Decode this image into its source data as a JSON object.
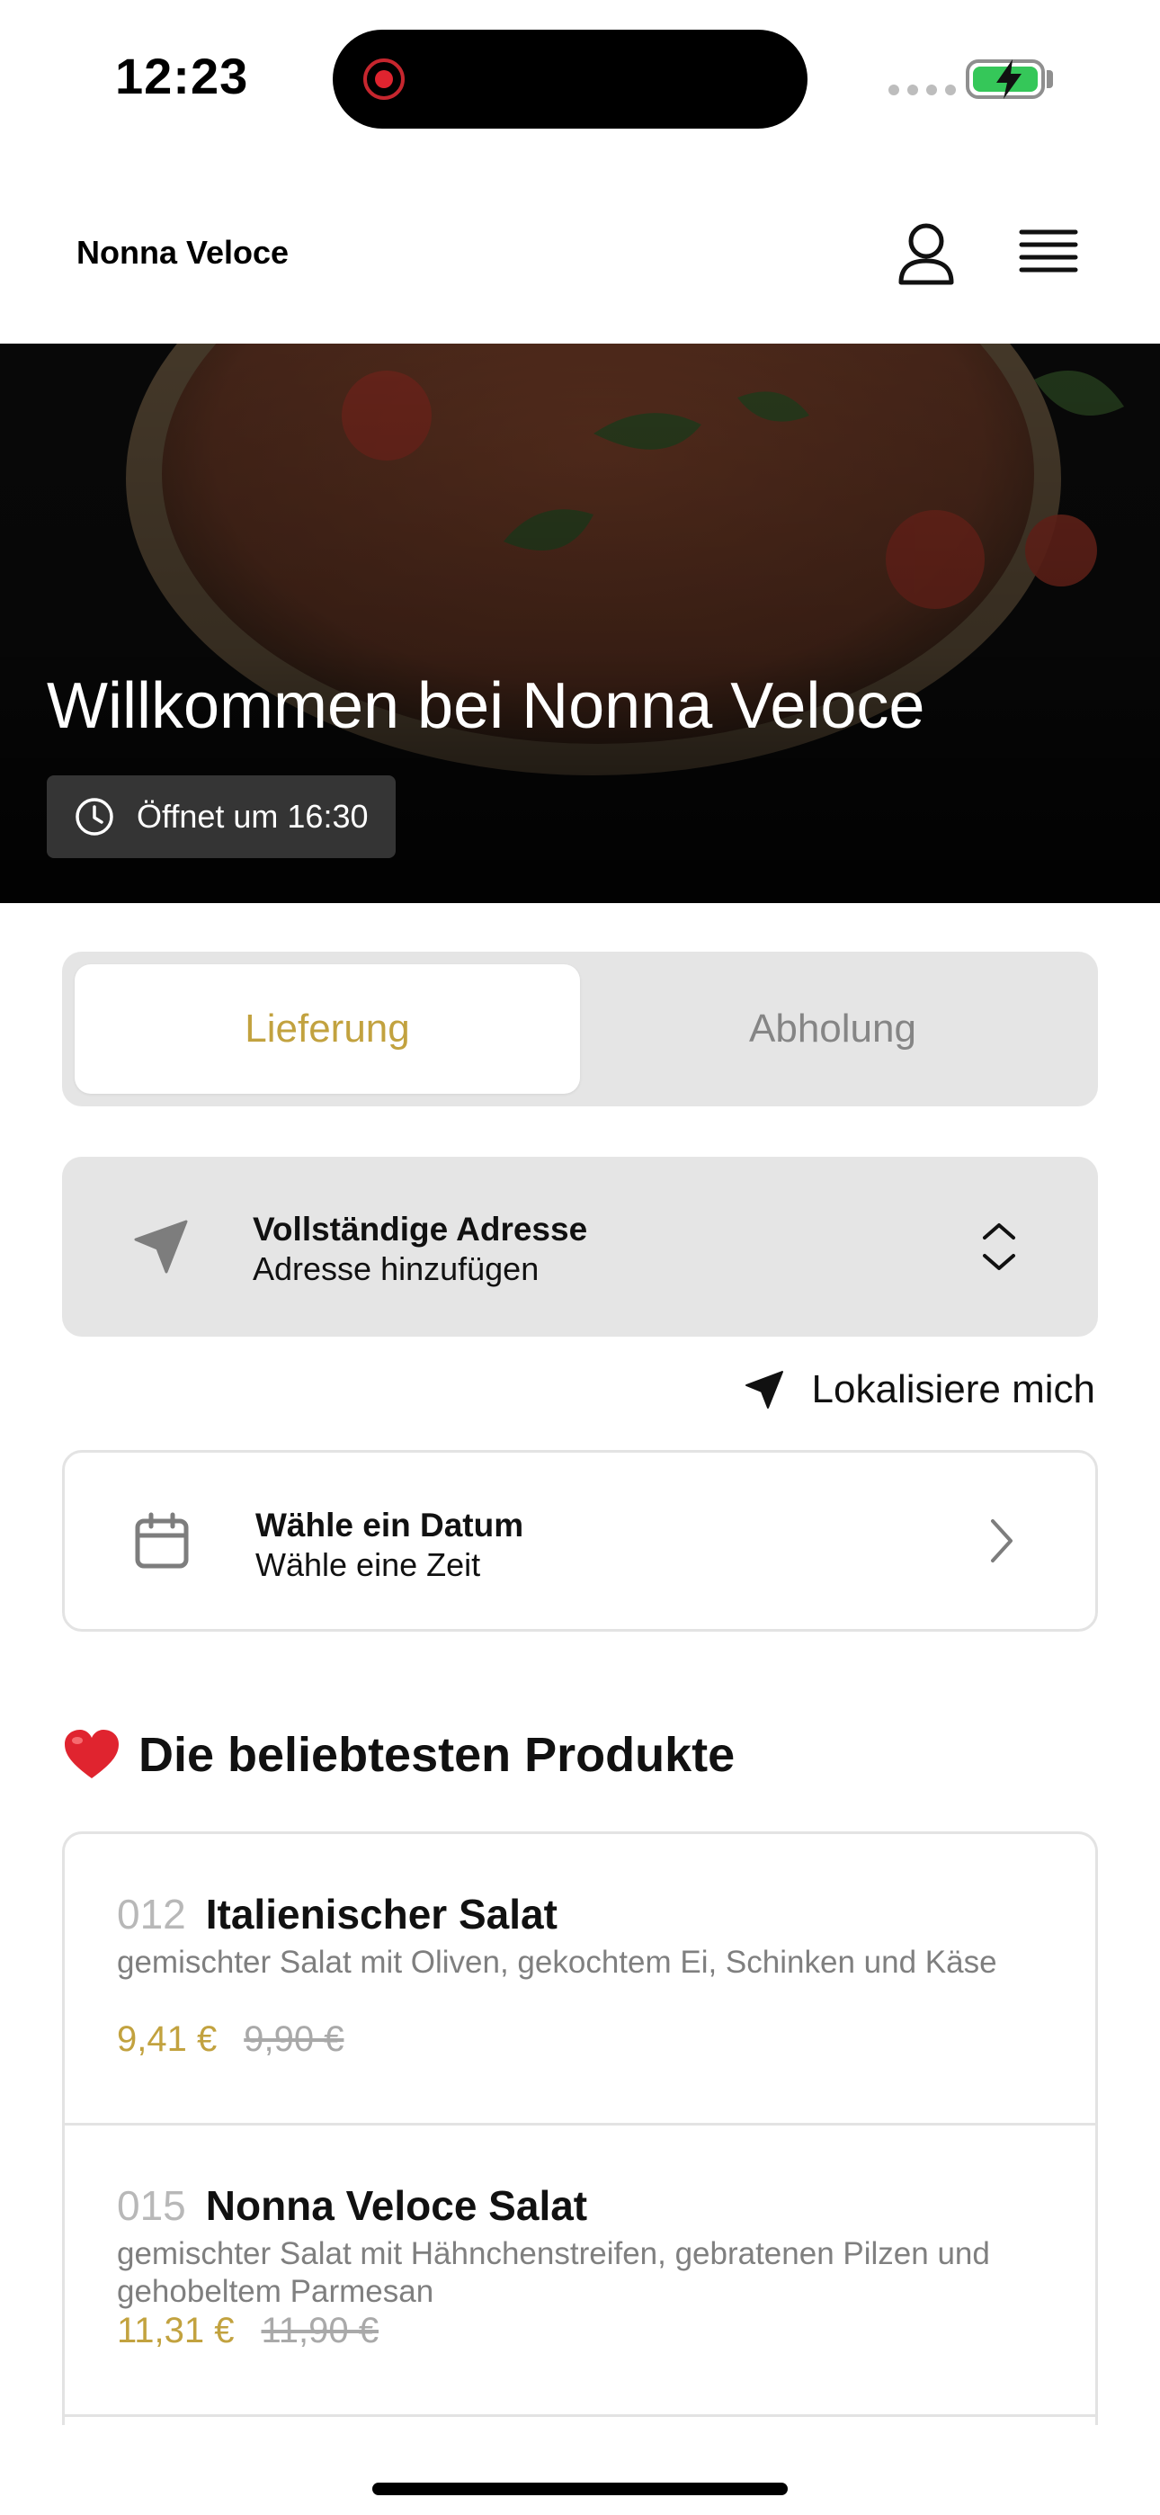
{
  "status_bar": {
    "time": "12:23"
  },
  "header": {
    "brand": "Nonna Veloce",
    "icons": [
      "user-icon",
      "menu-icon"
    ]
  },
  "hero": {
    "title": "Willkommen bei Nonna Veloce",
    "hours": "Öffnet um 16:30",
    "icon": "clock-icon"
  },
  "order_mode": {
    "options": [
      "Lieferung",
      "Abholung"
    ],
    "selected": "Lieferung"
  },
  "address": {
    "title": "Vollständige Adresse",
    "subtitle": "Adresse hinzufügen",
    "icon": "navigation-arrow-icon"
  },
  "locate": {
    "label": "Lokalisiere mich",
    "icon": "location-arrow-icon"
  },
  "date": {
    "title": "Wähle ein Datum",
    "subtitle": "Wähle eine Zeit",
    "icon": "calendar-icon"
  },
  "popular": {
    "emoji": "❤️",
    "title": "Die beliebtesten Produkte",
    "products": [
      {
        "number": "012",
        "name": "Italienischer Salat",
        "description": "gemischter Salat mit Oliven, gekochtem Ei, Schinken und Käse",
        "price": "9,41 €",
        "old_price": "9,90 €"
      },
      {
        "number": "015",
        "name": "Nonna Veloce Salat",
        "description": "gemischter Salat mit Hähnchenstreifen, gebratenen Pilzen und gehobeltem Parmesan",
        "price": "11,31 €",
        "old_price": "11,90 €"
      }
    ]
  },
  "colors": {
    "accent": "#c2a23f",
    "card_bg": "#e5e5e5",
    "muted_text": "#7f7f7f"
  }
}
